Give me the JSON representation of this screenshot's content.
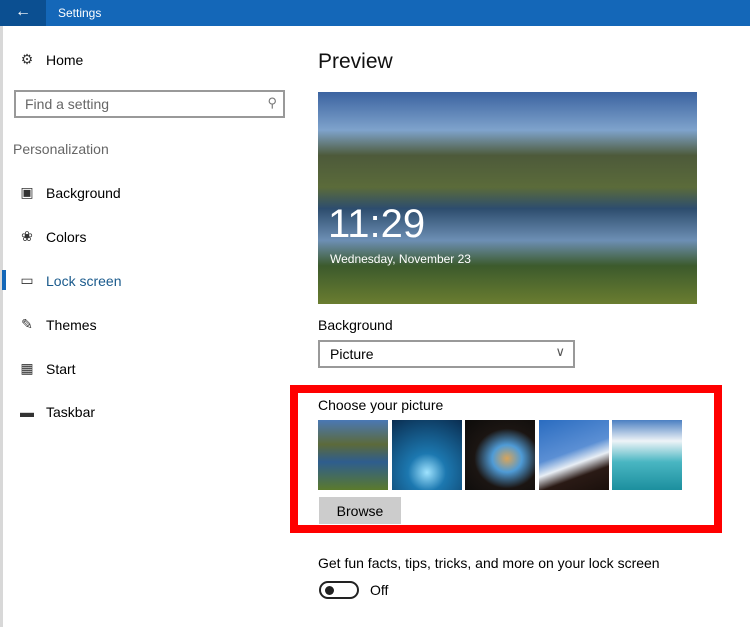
{
  "titlebar": {
    "title": "Settings",
    "back_icon": "arrow-left-icon"
  },
  "sidebar": {
    "home": "Home",
    "search_placeholder": "Find a setting",
    "section": "Personalization",
    "items": [
      {
        "label": "Background",
        "icon": "picture-icon"
      },
      {
        "label": "Colors",
        "icon": "palette-icon"
      },
      {
        "label": "Lock screen",
        "icon": "lock-screen-icon",
        "selected": true
      },
      {
        "label": "Themes",
        "icon": "themes-icon"
      },
      {
        "label": "Start",
        "icon": "start-icon"
      },
      {
        "label": "Taskbar",
        "icon": "taskbar-icon"
      }
    ]
  },
  "main": {
    "preview_heading": "Preview",
    "preview_time": "11:29",
    "preview_date": "Wednesday, November 23",
    "background_label": "Background",
    "background_value": "Picture",
    "choose_label": "Choose your picture",
    "browse": "Browse",
    "fun_facts": "Get fun facts, tips, tricks, and more on your lock screen",
    "toggle_state": "Off"
  },
  "colors": {
    "accent": "#1467b8",
    "highlight": "#ff0000"
  }
}
